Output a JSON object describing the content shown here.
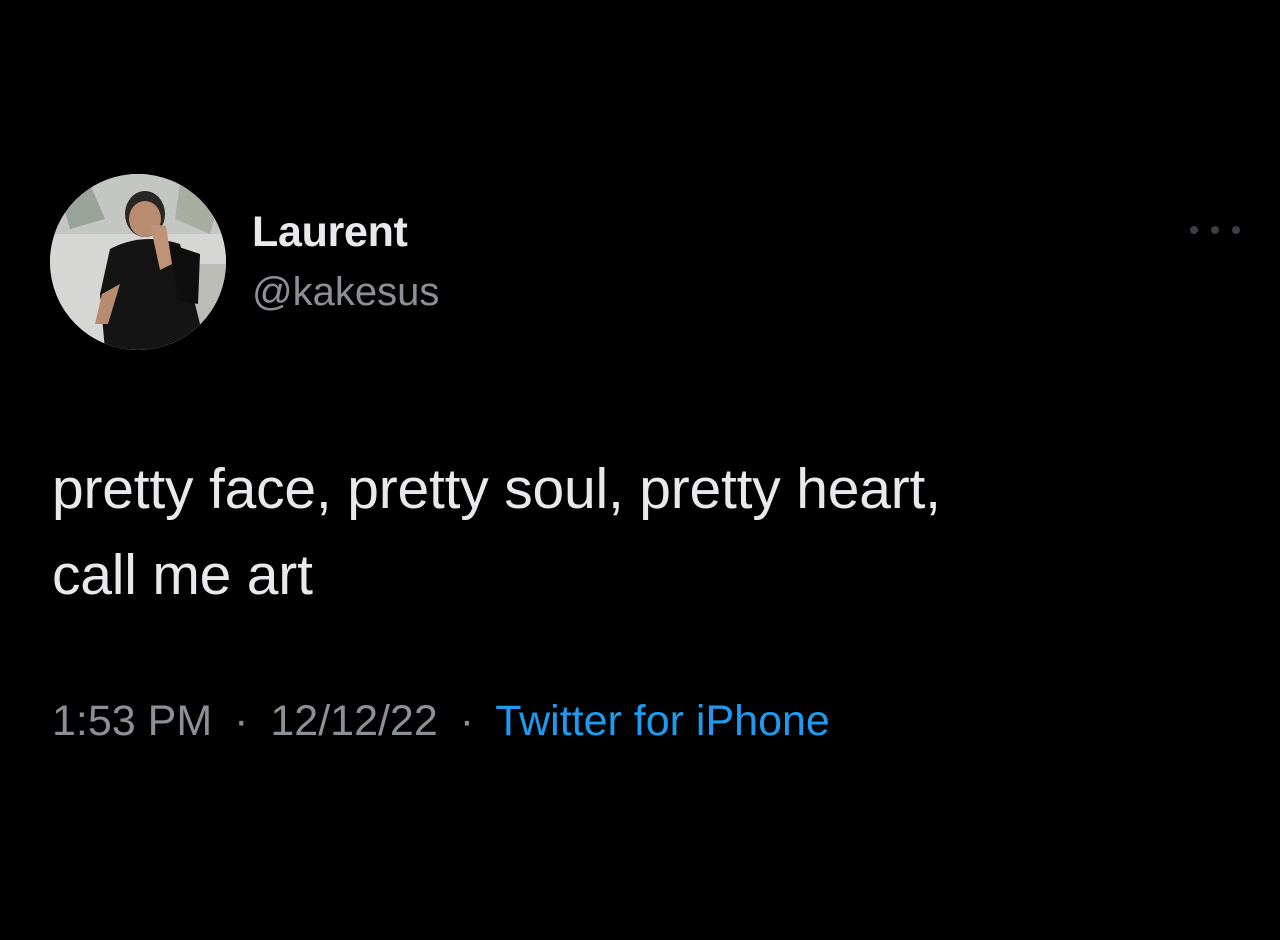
{
  "tweet": {
    "author": {
      "display_name": "Laurent",
      "handle": "@kakesus"
    },
    "text_line_1": "pretty face, pretty soul, pretty heart,",
    "text_line_2": "call me art",
    "time": "1:53 PM",
    "separator": "·",
    "date": "12/12/22",
    "source": "Twitter for iPhone"
  },
  "icons": {
    "more": "more-horizontal-icon"
  },
  "colors": {
    "background": "#000000",
    "primary_text": "#e7e9ea",
    "secondary_text": "#8b9095",
    "link": "#1d9bf0"
  }
}
